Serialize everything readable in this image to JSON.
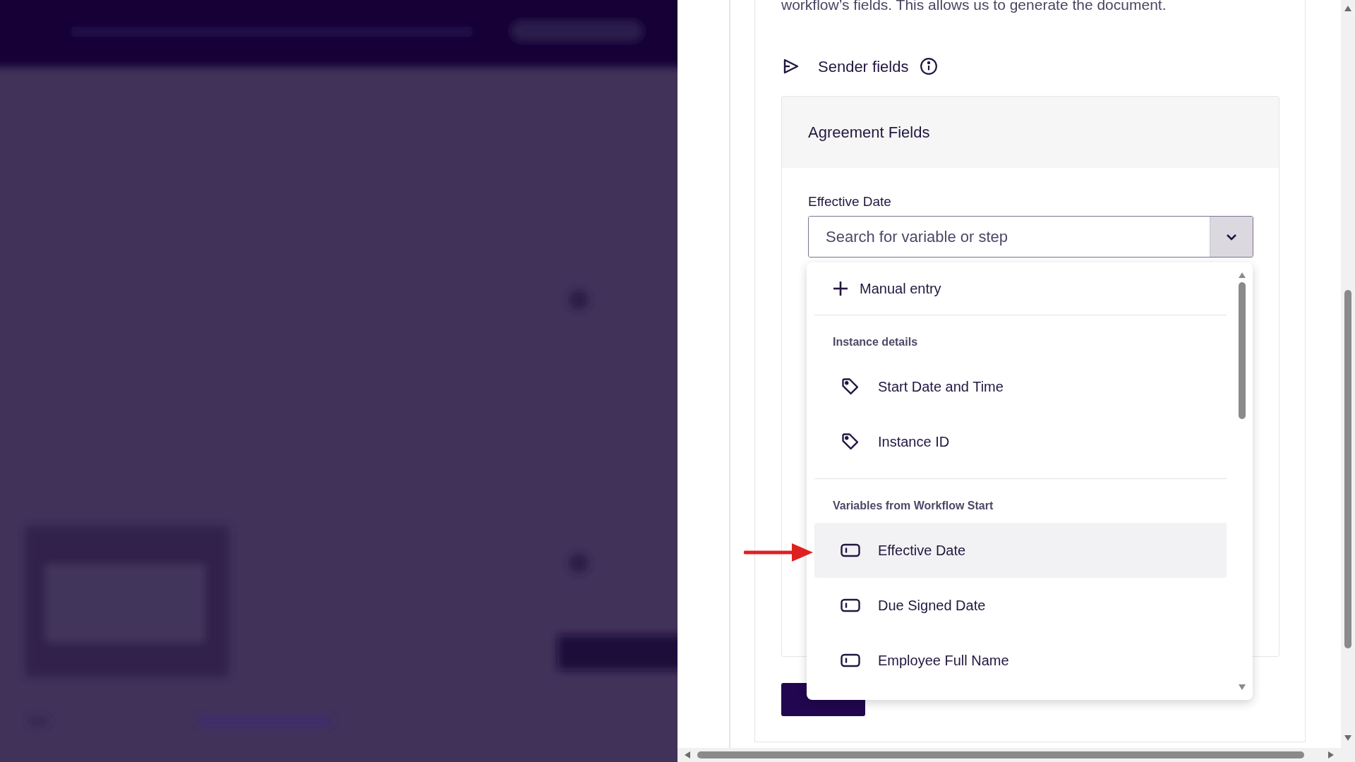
{
  "intro_text": "workflow’s fields. This allows us to generate the document.",
  "section": {
    "title": "Sender fields"
  },
  "card": {
    "title": "Agreement Fields",
    "field": {
      "label": "Effective Date",
      "placeholder": "Search for variable or step",
      "expanded": true
    }
  },
  "dropdown": {
    "action": "Manual entry",
    "groups": [
      {
        "heading": "Instance details",
        "items": [
          {
            "kind": "tag",
            "label": "Start Date and Time",
            "selected": false
          },
          {
            "kind": "tag",
            "label": "Instance ID",
            "selected": false
          }
        ]
      },
      {
        "heading": "Variables from Workflow Start",
        "items": [
          {
            "kind": "variable",
            "label": "Effective Date",
            "selected": true
          },
          {
            "kind": "variable",
            "label": "Due Signed Date",
            "selected": false
          },
          {
            "kind": "variable",
            "label": "Employee Full Name",
            "selected": false
          }
        ]
      }
    ]
  }
}
